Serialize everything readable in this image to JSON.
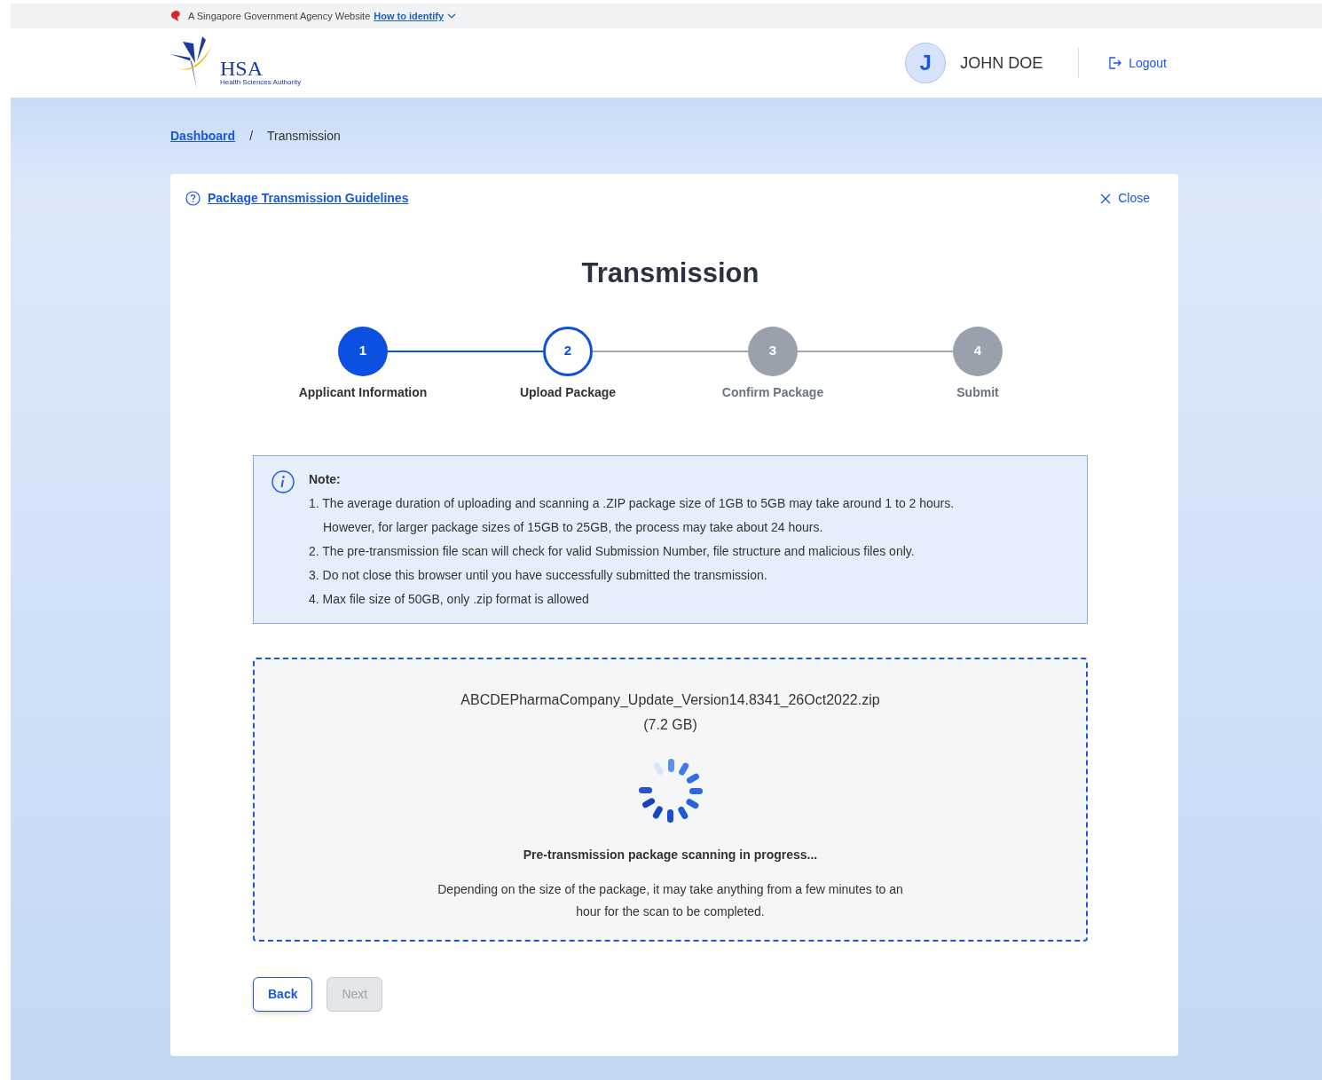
{
  "masthead": {
    "text": "A Singapore Government Agency Website",
    "link": "How to identify"
  },
  "header": {
    "logo": {
      "text": "HSA",
      "subtitle": "Health Sciences Authority"
    },
    "user": {
      "initial": "J",
      "name": "JOHN DOE"
    },
    "logout": "Logout"
  },
  "breadcrumb": {
    "separator": "/",
    "items": [
      {
        "label": "Dashboard",
        "link": true
      },
      {
        "label": "Transmission",
        "link": false
      }
    ]
  },
  "card": {
    "guidelines_link": "Package Transmission Guidelines",
    "close": "Close",
    "title": "Transmission",
    "steps": [
      {
        "number": "1",
        "label": "Applicant Information",
        "completed": true,
        "active": false
      },
      {
        "number": "2",
        "label": "Upload Package",
        "completed": false,
        "active": true
      },
      {
        "number": "3",
        "label": "Confirm Package",
        "completed": false,
        "active": false
      },
      {
        "number": "4",
        "label": "Submit",
        "completed": false,
        "active": false
      }
    ],
    "note": {
      "title": "Note:",
      "items": [
        "1. The average duration of uploading and scanning a .ZIP package size of 1GB to 5GB may take around 1 to 2 hours.",
        "However, for larger package sizes of 15GB to 25GB, the process may take about 24 hours.",
        "2. The pre-transmission file scan will check for valid Submission Number, file structure and malicious files only.",
        "3. Do not close this browser until you have successfully submitted the transmission.",
        "4. Max file size of 50GB, only .zip format is allowed"
      ]
    },
    "upload": {
      "file_name": "ABCDEPharmaCompany_Update_Version14.8341_26Oct2022.zip",
      "file_size": "(7.2 GB)",
      "status_title": "Pre-transmission package scanning in progress...",
      "status_text": "Depending on the size of the package, it may take anything from a few minutes to an hour for the scan to be completed."
    },
    "buttons": [
      {
        "label": "Back",
        "disabled": false
      },
      {
        "label": "Next",
        "disabled": true
      }
    ]
  }
}
